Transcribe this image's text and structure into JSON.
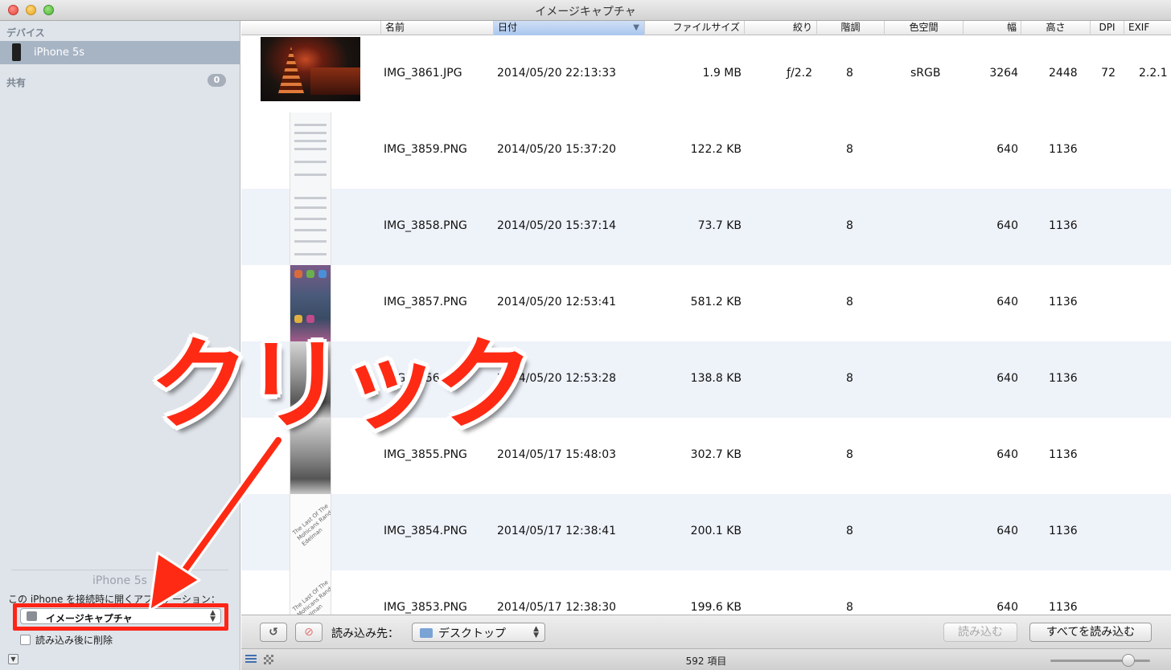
{
  "window": {
    "title": "イメージキャプチャ"
  },
  "sidebar": {
    "devices_heading": "デバイス",
    "device_name": "iPhone 5s",
    "shared_heading": "共有",
    "shared_count": "0",
    "device_caption": "iPhone 5s",
    "open_app_caption": "この iPhone を接続時に開くアプリケーション：",
    "open_app_value": "イメージキャプチャ",
    "delete_after_import": "読み込み後に削除"
  },
  "columns": [
    "名前",
    "日付",
    "ファイルサイズ",
    "絞り",
    "階調",
    "色空間",
    "幅",
    "高さ",
    "DPI",
    "EXIF"
  ],
  "rows": [
    {
      "name": "IMG_3861.JPG",
      "date": "2014/05/20 22:13:33",
      "size": "1.9 MB",
      "aperture": "ƒ/2.2",
      "depth": "8",
      "color": "sRGB",
      "width": "3264",
      "height": "2448",
      "dpi": "72",
      "exif": "2.2.1"
    },
    {
      "name": "IMG_3859.PNG",
      "date": "2014/05/20 15:37:20",
      "size": "122.2 KB",
      "aperture": "",
      "depth": "8",
      "color": "",
      "width": "640",
      "height": "1136",
      "dpi": "",
      "exif": ""
    },
    {
      "name": "IMG_3858.PNG",
      "date": "2014/05/20 15:37:14",
      "size": "73.7 KB",
      "aperture": "",
      "depth": "8",
      "color": "",
      "width": "640",
      "height": "1136",
      "dpi": "",
      "exif": ""
    },
    {
      "name": "IMG_3857.PNG",
      "date": "2014/05/20 12:53:41",
      "size": "581.2 KB",
      "aperture": "",
      "depth": "8",
      "color": "",
      "width": "640",
      "height": "1136",
      "dpi": "",
      "exif": ""
    },
    {
      "name": "IMG_3856.PNG",
      "date": "2014/05/20 12:53:28",
      "size": "138.8 KB",
      "aperture": "",
      "depth": "8",
      "color": "",
      "width": "640",
      "height": "1136",
      "dpi": "",
      "exif": ""
    },
    {
      "name": "IMG_3855.PNG",
      "date": "2014/05/17 15:48:03",
      "size": "302.7 KB",
      "aperture": "",
      "depth": "8",
      "color": "",
      "width": "640",
      "height": "1136",
      "dpi": "",
      "exif": ""
    },
    {
      "name": "IMG_3854.PNG",
      "date": "2014/05/17 12:38:41",
      "size": "200.1 KB",
      "aperture": "",
      "depth": "8",
      "color": "",
      "width": "640",
      "height": "1136",
      "dpi": "",
      "exif": ""
    },
    {
      "name": "IMG_3853.PNG",
      "date": "2014/05/17 12:38:30",
      "size": "199.6 KB",
      "aperture": "",
      "depth": "8",
      "color": "",
      "width": "640",
      "height": "1136",
      "dpi": "",
      "exif": ""
    }
  ],
  "thumbnails": {
    "lyric_text": "The Last Of The Mohicans Randy Edelman"
  },
  "toolbar": {
    "import_to_label": "読み込み先：",
    "destination": "デスクトップ",
    "import_button": "読み込む",
    "import_all_button": "すべてを読み込む"
  },
  "status": {
    "item_count": "592 項目"
  },
  "annotation": {
    "text": "クリック",
    "color": "#ff2a14"
  },
  "icons": {
    "rotate": "rotate-left-icon",
    "delete": "no-entry-icon",
    "folder": "folder-icon",
    "list_view": "list-view-icon",
    "grid_view": "grid-view-icon"
  }
}
